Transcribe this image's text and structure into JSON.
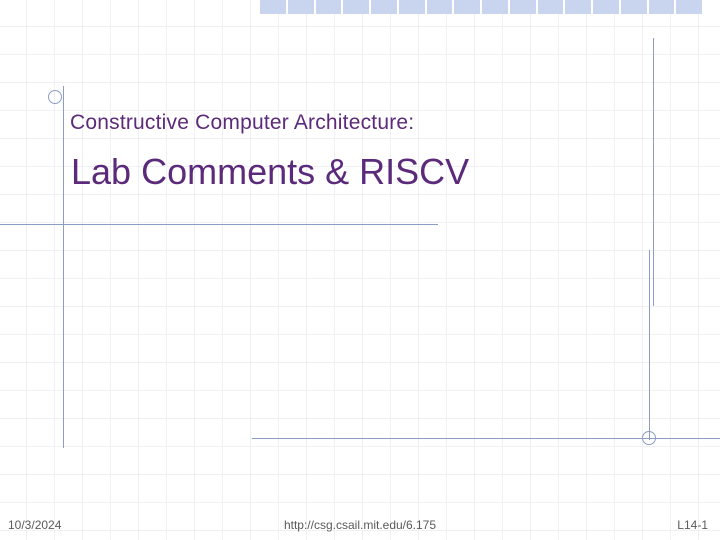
{
  "slide": {
    "subtitle": "Constructive Computer Architecture:",
    "title": "Lab Comments & RISCV"
  },
  "footer": {
    "date": "10/3/2024",
    "url": "http://csg.csail.mit.edu/6.175",
    "pageLabel": "L14-1"
  },
  "colors": {
    "accent": "#5c2a7a",
    "gridLine": "#eef0f4",
    "decorLine": "#8b9dc3",
    "topBar": "#c9d4ef"
  }
}
